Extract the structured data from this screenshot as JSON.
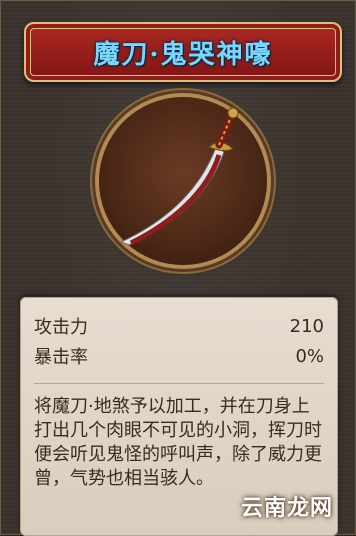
{
  "title": "魔刀·鬼哭神嚎",
  "stats": [
    {
      "label": "攻击力",
      "value": "210"
    },
    {
      "label": "暴击率",
      "value": "0%"
    }
  ],
  "description": "将魔刀·地煞予以加工，并在刀身上打出几个肉眼不可见的小洞，挥刀时便会听见鬼怪的呼叫声，除了威力更曾，气势也相当骇人。",
  "watermark": "云南龙网",
  "colors": {
    "title_text": "#79d6ff",
    "banner_red": "#9c1d18",
    "panel_bg": "#e7ddd0",
    "seal_bg": "#4b2716"
  }
}
